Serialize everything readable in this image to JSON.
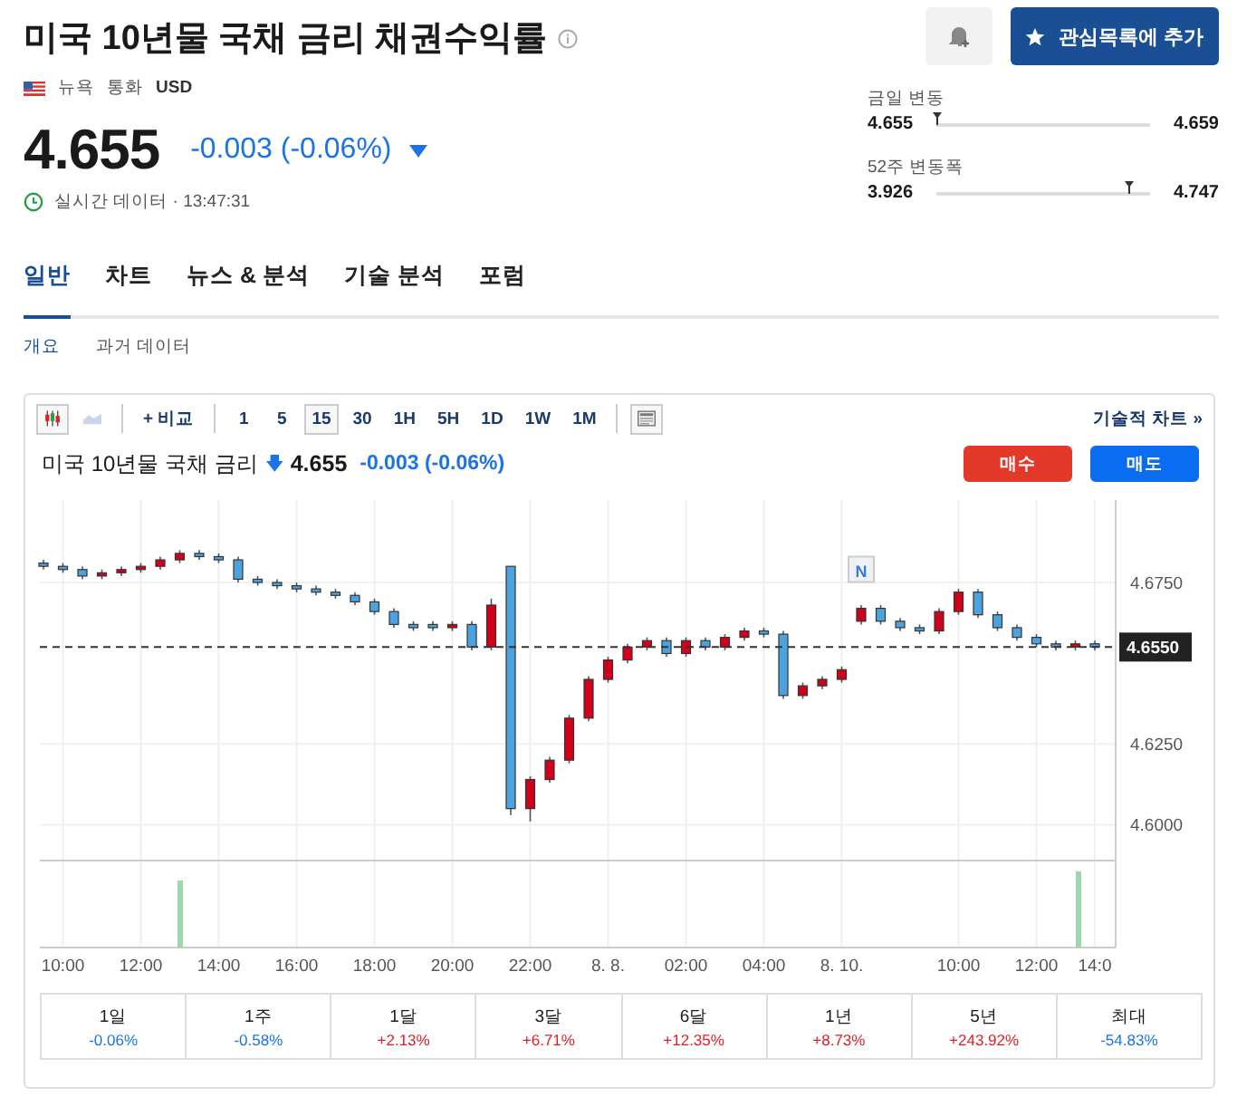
{
  "header": {
    "title": "미국 10년물 국채 금리 채권수익률",
    "exchange": "뉴욕",
    "currency_label": "통화",
    "currency": "USD",
    "watchlist_button": "관심목록에 추가"
  },
  "quote": {
    "price": "4.655",
    "change": "-0.003 (-0.06%)",
    "falling": true,
    "time_label": "실시간 데이터 · 13:47:31"
  },
  "ranges": [
    {
      "label": "금일 변동",
      "low": "4.655",
      "high": "4.659",
      "level": 0.0
    },
    {
      "label": "52주 변동폭",
      "low": "3.926",
      "high": "4.747",
      "level": 0.9
    }
  ],
  "tabs": [
    {
      "label": "일반",
      "selected": true
    },
    {
      "label": "차트",
      "selected": false
    },
    {
      "label": "뉴스 & 분석",
      "selected": false
    },
    {
      "label": "기술 분석",
      "selected": false
    },
    {
      "label": "포럼",
      "selected": false
    }
  ],
  "subtabs": [
    {
      "label": "개요",
      "selected": true
    },
    {
      "label": "과거 데이터",
      "selected": false
    }
  ],
  "chart": {
    "compare": "+ 비교",
    "intervals": [
      {
        "label": "1",
        "selected": false
      },
      {
        "label": "5",
        "selected": false
      },
      {
        "label": "15",
        "selected": true
      },
      {
        "label": "30",
        "selected": false
      },
      {
        "label": "1H",
        "selected": false
      },
      {
        "label": "5H",
        "selected": false
      },
      {
        "label": "1D",
        "selected": false
      },
      {
        "label": "1W",
        "selected": false
      },
      {
        "label": "1M",
        "selected": false
      }
    ],
    "technical_link": "기술적 차트 »",
    "name": "미국 10년물 국채 금리",
    "arrow": "🡇",
    "price": "4.655",
    "change": "-0.003 (-0.06%)",
    "buy": "매수",
    "sell": "매도",
    "price_tag": "4.6550",
    "news_marker": "N",
    "chart_data": {
      "type": "candlestick",
      "categories": [
        null,
        "10:00",
        null,
        null,
        null,
        "12:00",
        null,
        null,
        null,
        "14:00",
        null,
        null,
        null,
        "16:00",
        null,
        null,
        null,
        "18:00",
        null,
        null,
        null,
        "20:00",
        null,
        null,
        null,
        "22:00",
        null,
        null,
        null,
        "8. 8.",
        null,
        null,
        null,
        "02:00",
        null,
        null,
        null,
        "04:00",
        null,
        null,
        null,
        "8. 10.",
        null,
        null,
        null,
        null,
        null,
        "10:00",
        null,
        null,
        null,
        "12:00",
        null,
        null,
        "14:0"
      ],
      "ohlc": [
        [
          4.681,
          4.682,
          4.679,
          4.68
        ],
        [
          4.68,
          4.681,
          4.678,
          4.679
        ],
        [
          4.679,
          4.68,
          4.676,
          4.677
        ],
        [
          4.677,
          4.679,
          4.676,
          4.678
        ],
        [
          4.678,
          4.68,
          4.677,
          4.679
        ],
        [
          4.679,
          4.681,
          4.678,
          4.68
        ],
        [
          4.68,
          4.683,
          4.679,
          4.682
        ],
        [
          4.682,
          4.685,
          4.681,
          4.684
        ],
        [
          4.684,
          4.685,
          4.682,
          4.683
        ],
        [
          4.683,
          4.684,
          4.681,
          4.682
        ],
        [
          4.682,
          4.683,
          4.675,
          4.676
        ],
        [
          4.676,
          4.677,
          4.674,
          4.675
        ],
        [
          4.675,
          4.676,
          4.673,
          4.674
        ],
        [
          4.674,
          4.675,
          4.672,
          4.673
        ],
        [
          4.673,
          4.674,
          4.671,
          4.672
        ],
        [
          4.672,
          4.673,
          4.67,
          4.671
        ],
        [
          4.671,
          4.672,
          4.668,
          4.669
        ],
        [
          4.669,
          4.67,
          4.665,
          4.666
        ],
        [
          4.666,
          4.667,
          4.661,
          4.662
        ],
        [
          4.662,
          4.663,
          4.66,
          4.661
        ],
        [
          4.662,
          4.663,
          4.66,
          4.661
        ],
        [
          4.661,
          4.663,
          4.66,
          4.662
        ],
        [
          4.662,
          4.663,
          4.654,
          4.655
        ],
        [
          4.655,
          4.67,
          4.654,
          4.668
        ],
        [
          4.68,
          4.68,
          4.603,
          4.605
        ],
        [
          4.605,
          4.615,
          4.601,
          4.614
        ],
        [
          4.614,
          4.621,
          4.613,
          4.62
        ],
        [
          4.62,
          4.634,
          4.619,
          4.633
        ],
        [
          4.633,
          4.646,
          4.632,
          4.645
        ],
        [
          4.645,
          4.652,
          4.644,
          4.651
        ],
        [
          4.651,
          4.656,
          4.65,
          4.655
        ],
        [
          4.655,
          4.658,
          4.654,
          4.657
        ],
        [
          4.657,
          4.658,
          4.652,
          4.653
        ],
        [
          4.653,
          4.658,
          4.652,
          4.657
        ],
        [
          4.657,
          4.658,
          4.654,
          4.655
        ],
        [
          4.655,
          4.659,
          4.654,
          4.658
        ],
        [
          4.658,
          4.661,
          4.657,
          4.66
        ],
        [
          4.66,
          4.661,
          4.658,
          4.659
        ],
        [
          4.659,
          4.66,
          4.639,
          4.64
        ],
        [
          4.64,
          4.644,
          4.639,
          4.643
        ],
        [
          4.643,
          4.646,
          4.642,
          4.645
        ],
        [
          4.645,
          4.649,
          4.644,
          4.648
        ],
        [
          4.663,
          4.668,
          4.662,
          4.667
        ],
        [
          4.667,
          4.668,
          4.662,
          4.663
        ],
        [
          4.663,
          4.664,
          4.66,
          4.661
        ],
        [
          4.661,
          4.662,
          4.659,
          4.66
        ],
        [
          4.66,
          4.667,
          4.659,
          4.666
        ],
        [
          4.666,
          4.673,
          4.665,
          4.672
        ],
        [
          4.672,
          4.673,
          4.664,
          4.665
        ],
        [
          4.665,
          4.666,
          4.66,
          4.661
        ],
        [
          4.661,
          4.662,
          4.657,
          4.658
        ],
        [
          4.658,
          4.659,
          4.655,
          4.656
        ],
        [
          4.656,
          4.657,
          4.654,
          4.655
        ],
        [
          4.655,
          4.657,
          4.654,
          4.656
        ],
        [
          4.656,
          4.657,
          4.654,
          4.655
        ]
      ],
      "ylim": [
        4.562,
        4.6994
      ],
      "yticks": [
        {
          "value": 4.6,
          "label": "4.6000"
        },
        {
          "value": 4.625,
          "label": "4.6250"
        },
        {
          "value": 4.675,
          "label": "4.6750"
        }
      ],
      "grid": true
    }
  },
  "performance": [
    {
      "period": "1일",
      "change": "-0.06%",
      "negative": true
    },
    {
      "period": "1주",
      "change": "-0.58%",
      "negative": true
    },
    {
      "period": "1달",
      "change": "+2.13%",
      "negative": false
    },
    {
      "period": "3달",
      "change": "+6.71%",
      "negative": false
    },
    {
      "period": "6달",
      "change": "+12.35%",
      "negative": false
    },
    {
      "period": "1년",
      "change": "+8.73%",
      "negative": false
    },
    {
      "period": "5년",
      "change": "+243.92%",
      "negative": false
    },
    {
      "period": "최대",
      "change": "-54.83%",
      "negative": true
    }
  ]
}
